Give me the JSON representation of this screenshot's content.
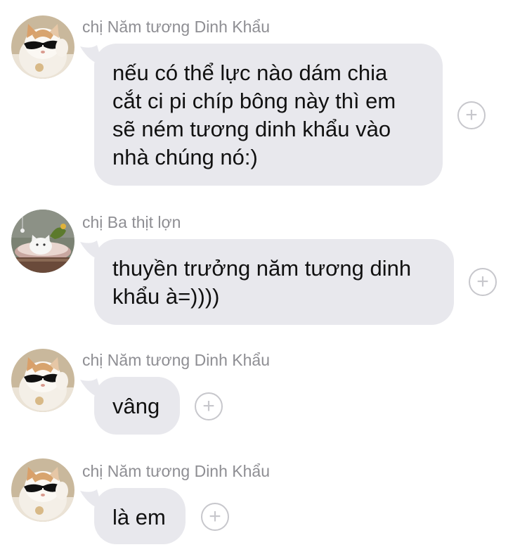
{
  "messages": [
    {
      "sender": "chị Năm tương Dinh Khẩu",
      "avatar_icon": "cool-cat-sunglasses-avatar",
      "lines": [
        "nếu có thể lực nào dám chia",
        "cắt ci pi chíp bông này thì em",
        "sẽ ném tương dinh khẩu vào",
        "nhà chúng nó:)"
      ]
    },
    {
      "sender": "chị Ba thịt lợn",
      "avatar_icon": "white-kitten-in-basket-avatar",
      "lines": [
        "thuyền trưởng năm tương dinh",
        "khẩu à=))))"
      ]
    },
    {
      "sender": "chị Năm tương Dinh Khẩu",
      "avatar_icon": "cool-cat-sunglasses-avatar",
      "lines": [
        "vâng"
      ]
    },
    {
      "sender": "chị Năm tương Dinh Khẩu",
      "avatar_icon": "cool-cat-sunglasses-avatar",
      "lines": [
        "là em"
      ]
    }
  ],
  "add_reaction_glyph": "+",
  "colors": {
    "bubble": "#e8e8ed",
    "sender_text": "#8e8e93",
    "add_button": "#c7c7cc"
  }
}
